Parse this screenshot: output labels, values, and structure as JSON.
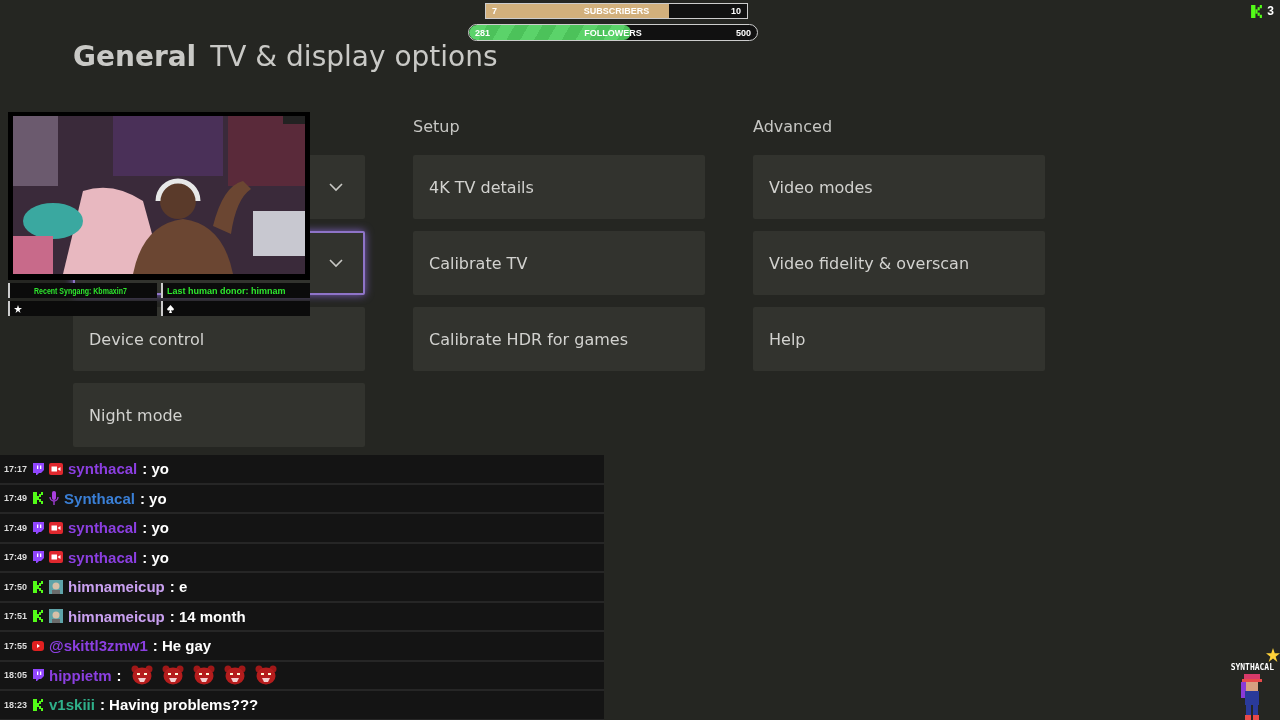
{
  "page": {
    "title_bold": "General",
    "title": "TV & display options"
  },
  "columns": [
    {
      "tiles": [
        {
          "kind": "dropdown",
          "selected": false
        },
        {
          "kind": "dropdown",
          "selected": true
        },
        {
          "kind": "link",
          "label": "Device control",
          "selected": false
        },
        {
          "kind": "link",
          "label": "Night mode",
          "selected": false
        }
      ]
    },
    {
      "heading": "Setup",
      "tiles": [
        {
          "kind": "link",
          "label": "4K TV details",
          "selected": false
        },
        {
          "kind": "link",
          "label": "Calibrate TV",
          "selected": false
        },
        {
          "kind": "link",
          "label": "Calibrate HDR for games",
          "selected": false
        }
      ]
    },
    {
      "heading": "Advanced",
      "tiles": [
        {
          "kind": "link",
          "label": "Video modes",
          "selected": false
        },
        {
          "kind": "link",
          "label": "Video fidelity & overscan",
          "selected": false
        },
        {
          "kind": "link",
          "label": "Help",
          "selected": false
        }
      ]
    }
  ],
  "goals": [
    {
      "kind": "box",
      "current": "7",
      "label": "SUBSCRIBERS",
      "target": "10",
      "level": 0.7
    },
    {
      "kind": "pill",
      "current": "281",
      "label": "FOLLOWERS",
      "target": "500",
      "level": 0.562
    }
  ],
  "viewers": {
    "count": "3"
  },
  "webcam": {
    "ticker": [
      {
        "left": "Recent Syngang: Kbmaxin7",
        "right": "Last human donor: himnam"
      }
    ]
  },
  "chat": [
    {
      "time": "17:17",
      "kind": "twitch_camera",
      "user": "synthacal",
      "color": "#8b3fe0",
      "text": ": yo"
    },
    {
      "time": "17:49",
      "kind": "kick_mic",
      "user": "Synthacal",
      "color": "#3a7fd6",
      "text": ": yo"
    },
    {
      "time": "17:49",
      "kind": "twitch_camera",
      "user": "synthacal",
      "color": "#8b3fe0",
      "text": ": yo"
    },
    {
      "time": "17:49",
      "kind": "twitch_camera",
      "user": "synthacal",
      "color": "#8b3fe0",
      "text": ": yo"
    },
    {
      "time": "17:50",
      "kind": "kick_avatar",
      "user": "himnameicup",
      "color": "#c9a0f0",
      "text": ": e"
    },
    {
      "time": "17:51",
      "kind": "kick_avatar",
      "user": "himnameicup",
      "color": "#c9a0f0",
      "text": ": 14 month"
    },
    {
      "time": "17:55",
      "kind": "youtube",
      "user": "@skittl3zmw1",
      "color": "#8b3fe0",
      "text": ": He gay"
    },
    {
      "time": "18:05",
      "kind": "twitch",
      "user": "hippietm",
      "color": "#8b3fe0",
      "text": ":",
      "emotes": [
        {
          "kind": "bear"
        },
        {
          "kind": "bear"
        },
        {
          "kind": "bear"
        },
        {
          "kind": "bear"
        },
        {
          "kind": "bear"
        }
      ]
    },
    {
      "time": "18:23",
      "kind": "kick",
      "user": "v1skiii",
      "color": "#2fb08a",
      "text": ": Having problems???"
    }
  ],
  "mascot": {
    "name": "SYNTHACAL"
  }
}
